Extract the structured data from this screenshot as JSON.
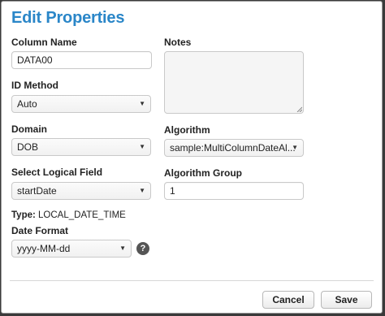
{
  "dialog": {
    "title": "Edit Properties"
  },
  "fields": {
    "column_name": {
      "label": "Column Name",
      "value": "DATA00"
    },
    "id_method": {
      "label": "ID Method",
      "value": "Auto"
    },
    "domain": {
      "label": "Domain",
      "value": "DOB"
    },
    "select_logical_field": {
      "label": "Select Logical Field",
      "value": "startDate"
    },
    "type": {
      "label": "Type:",
      "value": "LOCAL_DATE_TIME"
    },
    "date_format": {
      "label": "Date Format",
      "value": "yyyy-MM-dd",
      "help_icon": "?"
    },
    "notes": {
      "label": "Notes",
      "value": ""
    },
    "algorithm": {
      "label": "Algorithm",
      "value": "sample:MultiColumnDateAl..."
    },
    "algorithm_group": {
      "label": "Algorithm Group",
      "value": "1"
    }
  },
  "footer": {
    "cancel_label": "Cancel",
    "save_label": "Save"
  },
  "icons": {
    "dropdown": "chevron-down-icon",
    "help": "help-icon",
    "resize": "resize-grip-icon"
  },
  "colors": {
    "title": "#2a86c8"
  }
}
